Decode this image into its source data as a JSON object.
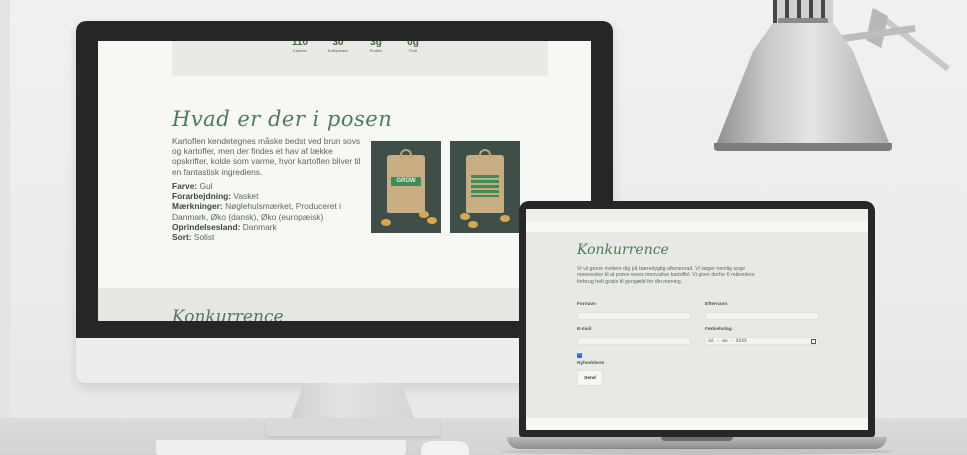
{
  "desktop": {
    "nutrition": [
      {
        "value": "110",
        "label": "Kalorier"
      },
      {
        "value": "30",
        "label": "Kulhydrater"
      },
      {
        "value": "3g",
        "label": "Protein"
      },
      {
        "value": "0g",
        "label": "Fedt"
      }
    ],
    "section_title": "Hvad er der i posen",
    "description": "Kartoflen kendetegnes måske bedst ved brun sovs og kartofler, men der findes et hav af lække opskrifter, kolde som varme, hvor kartoflen bliver til en fantastisk ingrediens.",
    "specs": [
      {
        "label": "Farve:",
        "value": "Gul"
      },
      {
        "label": "Forarbejdning:",
        "value": "Vasket"
      },
      {
        "label": "Mærkninger:",
        "value": "Nøglehulsmærket, Produceret i Danmark, Øko (dansk), Øko (europæisk)"
      },
      {
        "label": "Oprindelsesland:",
        "value": "Danmark"
      },
      {
        "label": "Sort:",
        "value": "Solist"
      }
    ],
    "product_brand": "GROW",
    "next_section_title": "Konkurrence"
  },
  "laptop": {
    "title": "Konkurrence",
    "intro": "Vi vil gerne invitere dig på bæredygtig aftenernad. Vi søger nemlig unge mennesker til at prøve vores innovative kartoffel. Vi giver derfor 6 måneders forbrug helt gratis til gengæld for din mening.",
    "fields": {
      "first_name_label": "Fornavn",
      "last_name_label": "Efternavn",
      "email_label": "E-mail",
      "birthday_label": "Fødselsdag",
      "birthday_placeholder": "dd - mm - åååå",
      "newsletter_label": "Nyhedsbrev"
    },
    "newsletter_checked": true,
    "send_label": "Send"
  },
  "colors": {
    "brand_green": "#4f7b58",
    "checkbox_blue": "#2f6bd6",
    "device_black": "#262626"
  }
}
